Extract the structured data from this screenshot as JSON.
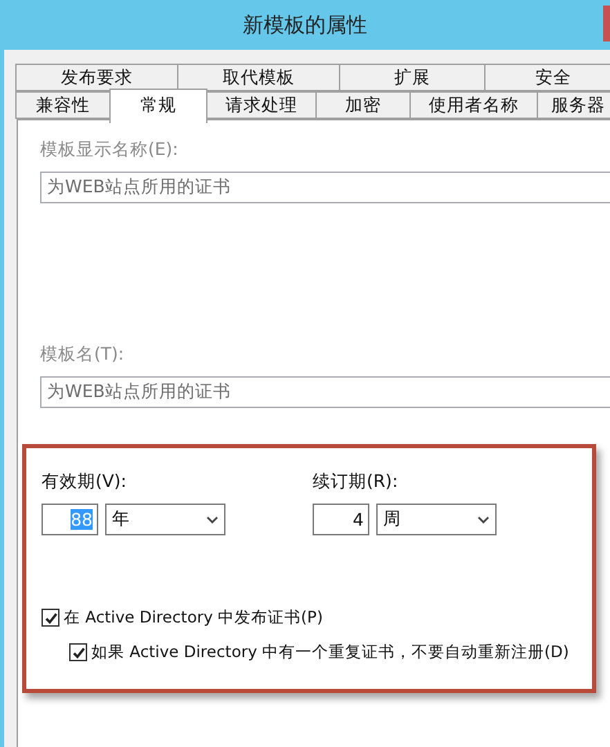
{
  "window": {
    "title": "新模板的属性"
  },
  "tab_rows": [
    [
      {
        "label": "发布要求",
        "selected": false
      },
      {
        "label": "取代模板",
        "selected": false
      },
      {
        "label": "扩展",
        "selected": false
      },
      {
        "label": "安全",
        "selected": false
      }
    ],
    [
      {
        "label": "兼容性",
        "selected": false
      },
      {
        "label": "常规",
        "selected": true
      },
      {
        "label": "请求处理",
        "selected": false
      },
      {
        "label": "加密",
        "selected": false
      },
      {
        "label": "使用者名称",
        "selected": false
      },
      {
        "label": "服务器",
        "selected": false
      }
    ]
  ],
  "fields": [
    {
      "label": "模板显示名称(E):",
      "value": "为WEB站点所用的证书",
      "disabled": true
    },
    {
      "label": "模板名(T):",
      "value": "为WEB站点所用的证书",
      "disabled": true
    }
  ],
  "periods": [
    {
      "label": "有效期(V):",
      "number": "88",
      "text_selected": true,
      "unit": "年"
    },
    {
      "label": "续订期(R):",
      "number": "4",
      "text_selected": false,
      "unit": "周"
    }
  ],
  "checkboxes": [
    {
      "label": "在 Active Directory 中发布证书(P)",
      "checked": true,
      "children": [
        {
          "label": "如果 Active Directory 中有一个重复证书，不要自动重新注册(D)",
          "checked": true
        }
      ]
    }
  ]
}
